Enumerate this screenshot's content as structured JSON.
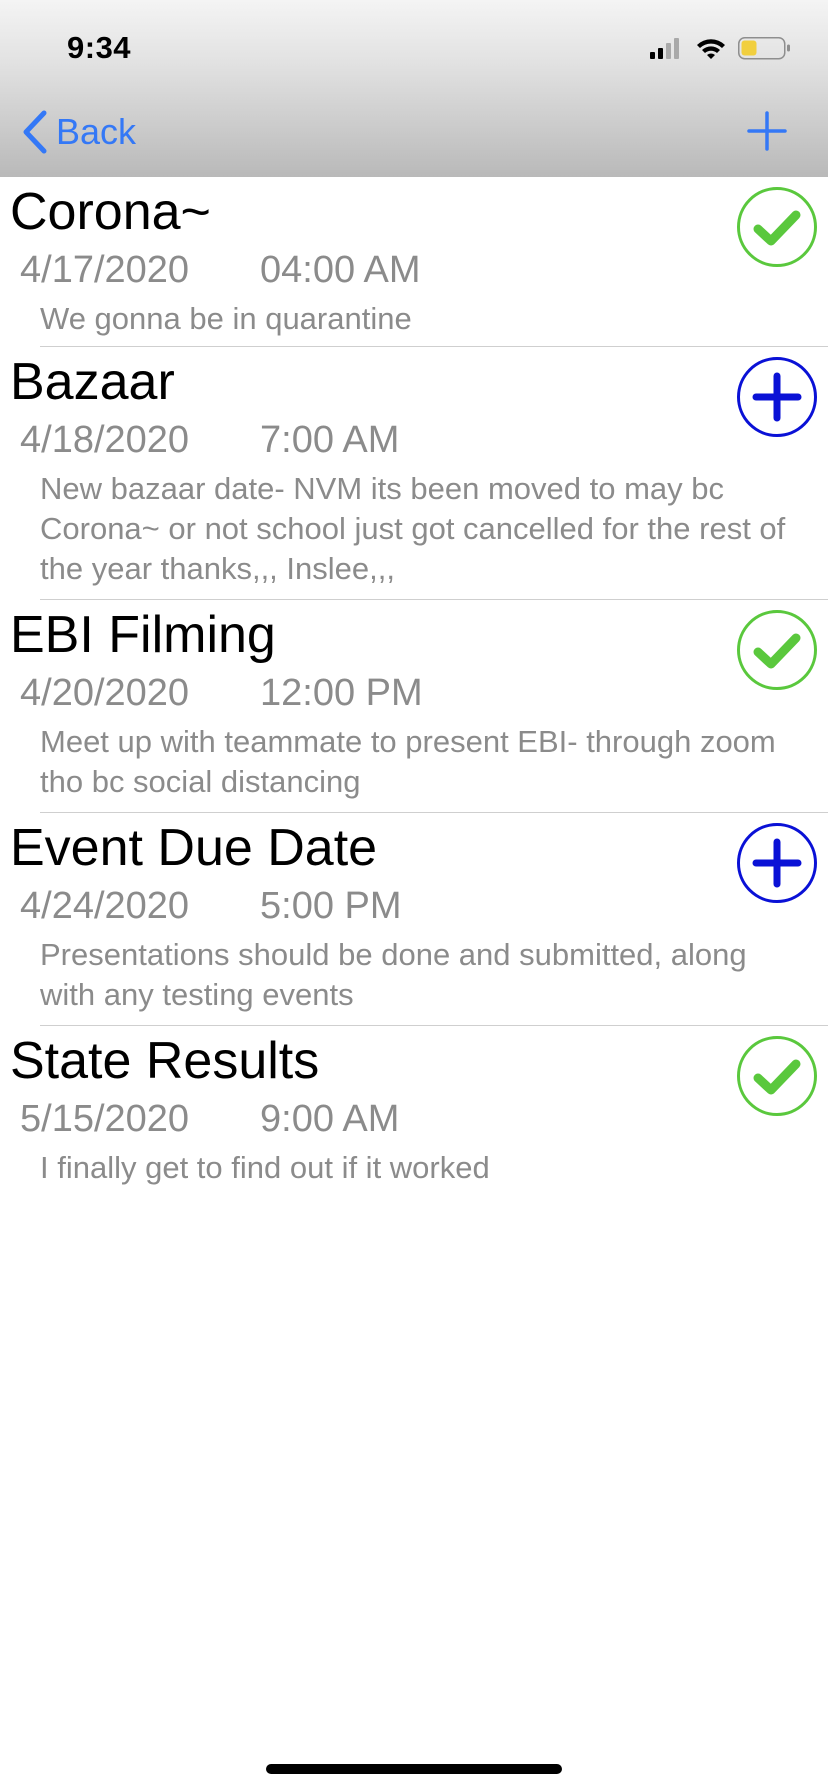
{
  "colors": {
    "accent": "#3478f6",
    "done_green": "#5ac83d",
    "pending_blue": "#0a11d6",
    "subtext_gray": "#8b8b8b"
  },
  "status_bar": {
    "time": "9:34",
    "icons": [
      "cellular-signal-icon",
      "wifi-icon",
      "battery-icon"
    ]
  },
  "nav": {
    "back_label": "Back",
    "back_icon": "chevron-left-icon",
    "add_icon": "plus-icon"
  },
  "events": [
    {
      "title": "Corona~",
      "date": "4/17/2020",
      "time": "04:00 AM",
      "notes": "We gonna be in quarantine",
      "status": "done",
      "status_icon": "checkmark-circle-icon"
    },
    {
      "title": "Bazaar",
      "date": "4/18/2020",
      "time": "7:00 AM",
      "notes": "New bazaar date- NVM its been moved to may bc Corona~ or not school just got cancelled for the rest of the year thanks,,, Inslee,,,",
      "status": "pending",
      "status_icon": "plus-circle-icon"
    },
    {
      "title": "EBI Filming",
      "date": "4/20/2020",
      "time": "12:00 PM",
      "notes": "Meet up with teammate to present EBI- through zoom tho bc social distancing",
      "status": "done",
      "status_icon": "checkmark-circle-icon"
    },
    {
      "title": "Event Due Date",
      "date": "4/24/2020",
      "time": "5:00 PM",
      "notes": "Presentations should be done and submitted, along with any testing events",
      "status": "pending",
      "status_icon": "plus-circle-icon"
    },
    {
      "title": "State Results",
      "date": "5/15/2020",
      "time": "9:00 AM",
      "notes": "I finally get to find out if it worked",
      "status": "done",
      "status_icon": "checkmark-circle-icon"
    }
  ]
}
